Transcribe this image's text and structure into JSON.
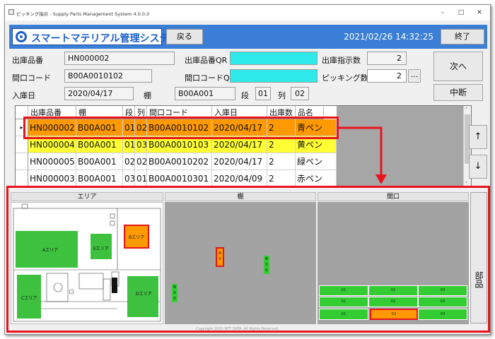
{
  "window": {
    "title": "ピッキング指示 - Supply Parts Management System 4.0.0.0",
    "minimize": "–",
    "maximize": "□",
    "close": "✕"
  },
  "header": {
    "logo_text": "スマートマテリアル管理システム",
    "back_label": "戻る",
    "datetime": "2021/02/26 14:32:25",
    "exit_label": "終了"
  },
  "form": {
    "out_part_no_label": "出庫品番",
    "out_part_no_value": "HN000002",
    "out_part_qr_label": "出庫品番QR",
    "out_part_qr_value": "",
    "out_instruction_count_label": "出庫指示数",
    "out_instruction_count_value": "2",
    "frontage_code_label": "間口コード",
    "frontage_code_value": "B00A0010102",
    "frontage_qr_label": "間口コードQR",
    "frontage_qr_value": "",
    "picking_count_label": "ピッキング数",
    "picking_count_value": "2",
    "ellipsis_label": "...",
    "in_date_label": "入庫日",
    "in_date_value": "2020/04/17",
    "shelf_label": "棚",
    "shelf_value": "B00A001",
    "tier_label": "段",
    "tier_value": "01",
    "column_label": "列",
    "column_value": "02",
    "next_label": "次へ",
    "interrupt_label": "中断"
  },
  "table": {
    "columns": [
      "出庫品番",
      "棚",
      "段",
      "列",
      "間口コード",
      "入庫日",
      "出庫数",
      "品名"
    ],
    "rows": [
      {
        "part": "HN000002",
        "shelf": "B00A001",
        "tier": "01",
        "col": "02",
        "code": "B00A0010102",
        "date": "2020/04/17",
        "qty": "2",
        "name": "青ペン",
        "bg": "#ff9900",
        "marker": "▸"
      },
      {
        "part": "HN000004",
        "shelf": "B00A001",
        "tier": "01",
        "col": "03",
        "code": "B00A0010103",
        "date": "2020/04/17",
        "qty": "2",
        "name": "黄ペン",
        "bg": "#ffff33",
        "marker": ""
      },
      {
        "part": "HN000005",
        "shelf": "B00A001",
        "tier": "02",
        "col": "02",
        "code": "B00A0010202",
        "date": "2020/04/17",
        "qty": "2",
        "name": "緑ペン",
        "bg": "#ffffff",
        "marker": ""
      },
      {
        "part": "HN000003",
        "shelf": "B00A001",
        "tier": "03",
        "col": "01",
        "code": "B00A0010301",
        "date": "2020/04/09",
        "qty": "2",
        "name": "赤ペン",
        "bg": "#ffffff",
        "marker": ""
      }
    ],
    "up_label": "↑",
    "down_label": "↓"
  },
  "panels": {
    "area_label": "エリア",
    "shelf_label": "棚",
    "frontage_label": "間口",
    "parts_label": "部品"
  },
  "area_map": {
    "a_area": "Aエリア",
    "e_area": "Eエリア",
    "b_area": "Bエリア",
    "c_area": "Cエリア",
    "d_area": "Dエリア"
  },
  "shelf_map": {
    "highlight_shelf": "B 0",
    "shelf_b00_right": "B 0 0",
    "shelf_b00_left": "B 0 0"
  },
  "frontage_map": {
    "rows": [
      [
        "01",
        "02",
        "03"
      ],
      [
        "01",
        "02",
        "03"
      ],
      [
        "01",
        "02",
        "03"
      ]
    ],
    "selected_row": 2,
    "selected_col": 1
  },
  "footer_text": "Copyright 2020 NTT DATA. All Rights Reserved.",
  "colors": {
    "accent": "#3a7fd5",
    "selection": "#ff9900",
    "warning": "#ffff33",
    "qr_field": "#2ee9ea",
    "zone": "#33cc33",
    "highlight_border": "#e8141c"
  }
}
